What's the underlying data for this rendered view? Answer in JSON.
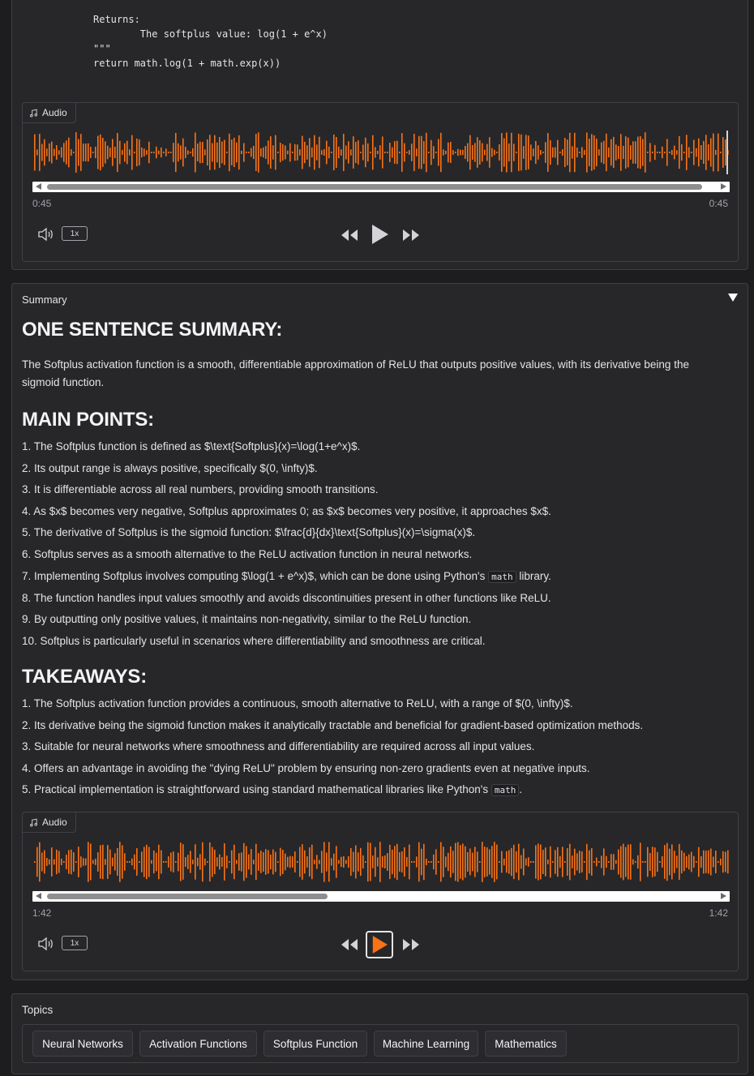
{
  "code": {
    "lines": [
      "Returns:",
      "        The softplus value: log(1 + e^x)",
      "\"\"\"",
      "return math.log(1 + math.exp(x))"
    ]
  },
  "audio1": {
    "label": "Audio",
    "current_time": "0:45",
    "duration": "0:45",
    "speed": "1x",
    "scroll_fraction": 0.98,
    "wave_color": "#f97316"
  },
  "summary": {
    "label": "Summary",
    "one_sentence_heading": "ONE SENTENCE SUMMARY:",
    "one_sentence": "The Softplus activation function is a smooth, differentiable approximation of ReLU that outputs positive values, with its derivative being the sigmoid function.",
    "main_points_heading": "MAIN POINTS:",
    "main_points": [
      "1. The Softplus function is defined as $\\text{Softplus}(x)=\\log(1+e^x)$.",
      "2. Its output range is always positive, specifically $(0, \\infty)$.",
      "3. It is differentiable across all real numbers, providing smooth transitions.",
      "4. As $x$ becomes very negative, Softplus approximates 0; as $x$ becomes very positive, it approaches $x$.",
      "5. The derivative of Softplus is the sigmoid function: $\\frac{d}{dx}\\text{Softplus}(x)=\\sigma(x)$.",
      "6. Softplus serves as a smooth alternative to the ReLU activation function in neural networks.",
      "7. Implementing Softplus involves computing $\\log(1 + e^x)$, which can be done using Python's ",
      "8. The function handles input values smoothly and avoids discontinuities present in other functions like ReLU.",
      "9. By outputting only positive values, it maintains non-negativity, similar to the ReLU function.",
      "10. Softplus is particularly useful in scenarios where differentiability and smoothness are critical."
    ],
    "point7_code": "math",
    "point7_suffix": " library.",
    "takeaways_heading": "TAKEAWAYS:",
    "takeaways": [
      "1. The Softplus activation function provides a continuous, smooth alternative to ReLU, with a range of $(0, \\infty)$.",
      "2. Its derivative being the sigmoid function makes it analytically tractable and beneficial for gradient-based optimization methods.",
      "3. Suitable for neural networks where smoothness and differentiability are required across all input values.",
      "4. Offers an advantage in avoiding the \"dying ReLU\" problem by ensuring non-zero gradients even at negative inputs.",
      "5. Practical implementation is straightforward using standard mathematical libraries like Python's "
    ],
    "takeaway5_code": "math",
    "takeaway5_suffix": "."
  },
  "audio2": {
    "label": "Audio",
    "current_time": "1:42",
    "duration": "1:42",
    "speed": "1x",
    "scroll_fraction": 0.42,
    "wave_color": "#f97316",
    "play_highlight": "#f97316"
  },
  "topics": {
    "label": "Topics",
    "items": [
      "Neural Networks",
      "Activation Functions",
      "Softplus Function",
      "Machine Learning",
      "Mathematics"
    ]
  }
}
